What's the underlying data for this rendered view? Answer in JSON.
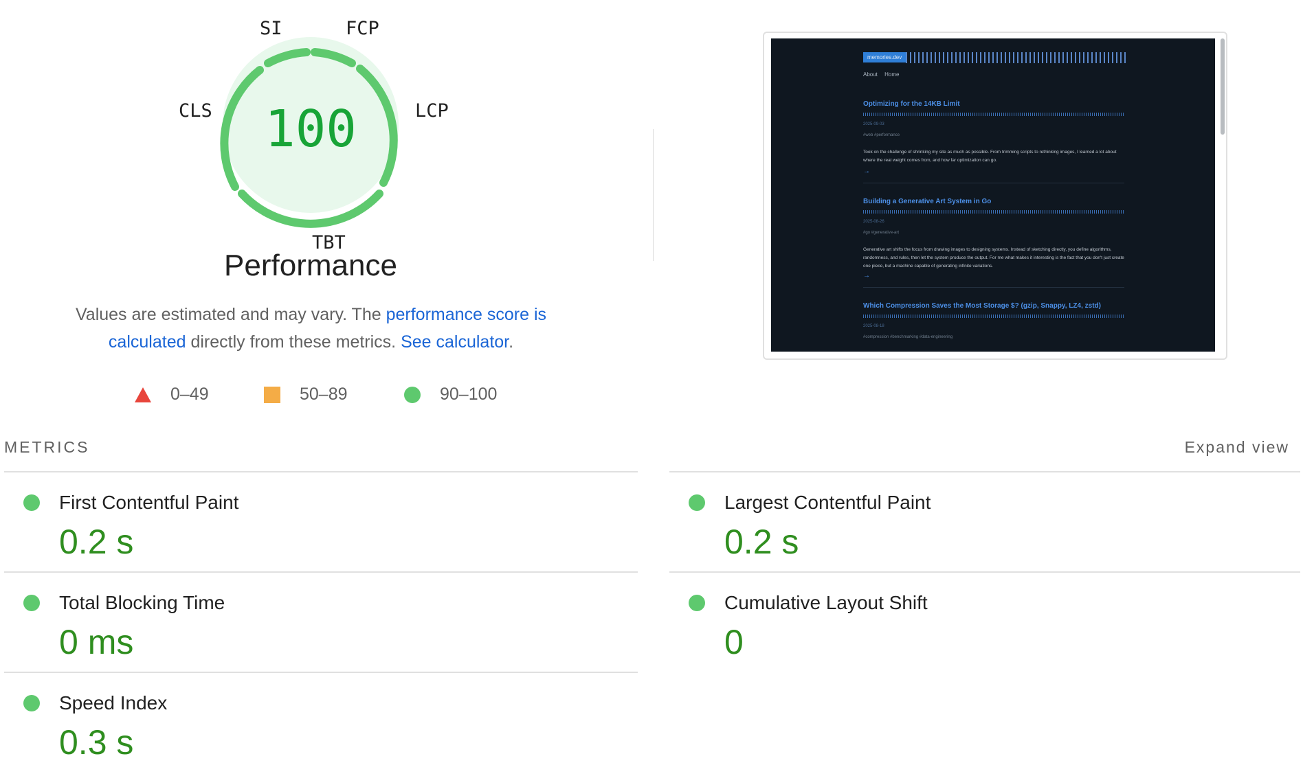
{
  "gauge": {
    "score": "100",
    "labels": {
      "si": "SI",
      "fcp": "FCP",
      "lcp": "LCP",
      "tbt": "TBT",
      "cls": "CLS"
    },
    "title": "Performance",
    "color_ring": "#5ec96e",
    "color_fill": "#e8f8ec",
    "color_text": "#18a437"
  },
  "description": {
    "part1": "Values are estimated and may vary. The ",
    "link1": "performance score is calculated",
    "part2": " directly from these metrics. ",
    "link2": "See calculator",
    "part3": "."
  },
  "legend": [
    {
      "shape": "triangle",
      "label": "0–49",
      "color": "#e8453c"
    },
    {
      "shape": "square",
      "label": "50–89",
      "color": "#f4ac46"
    },
    {
      "shape": "circle",
      "label": "90–100",
      "color": "#5ec96e"
    }
  ],
  "thumbnail": {
    "logo": "memories.dev",
    "nav": "About Home",
    "posts": [
      {
        "title": "Optimizing for the 14KB Limit",
        "date": "2025-09-03",
        "tags": "#web #performance",
        "body": "Took on the challenge of shrinking my site as much as possible. From trimming scripts to rethinking images, I learned a lot about where the real weight comes from, and how far optimization can go."
      },
      {
        "title": "Building a Generative Art System in Go",
        "date": "2025-08-26",
        "tags": "#go #generative-art",
        "body": "Generative art shifts the focus from drawing images to designing systems. Instead of sketching directly, you define algorithms, randomness, and rules, then let the system produce the output. For me what makes it interesting is the fact that you don't just create one piece, but a machine capable of generating infinite variations."
      },
      {
        "title": "Which Compression Saves the Most Storage $? (gzip, Snappy, LZ4, zstd)",
        "date": "2025-08-18",
        "tags": "#compression #benchmarking #data-engineering",
        "body": ""
      }
    ],
    "arrow": "→"
  },
  "metrics": {
    "title": "METRICS",
    "expand_label": "Expand view",
    "items": [
      {
        "name": "First Contentful Paint",
        "value": "0.2 s"
      },
      {
        "name": "Largest Contentful Paint",
        "value": "0.2 s"
      },
      {
        "name": "Total Blocking Time",
        "value": "0 ms"
      },
      {
        "name": "Cumulative Layout Shift",
        "value": "0"
      },
      {
        "name": "Speed Index",
        "value": "0.3 s"
      }
    ],
    "status_color": "#5ec96e",
    "value_color": "#2f8e1f"
  }
}
